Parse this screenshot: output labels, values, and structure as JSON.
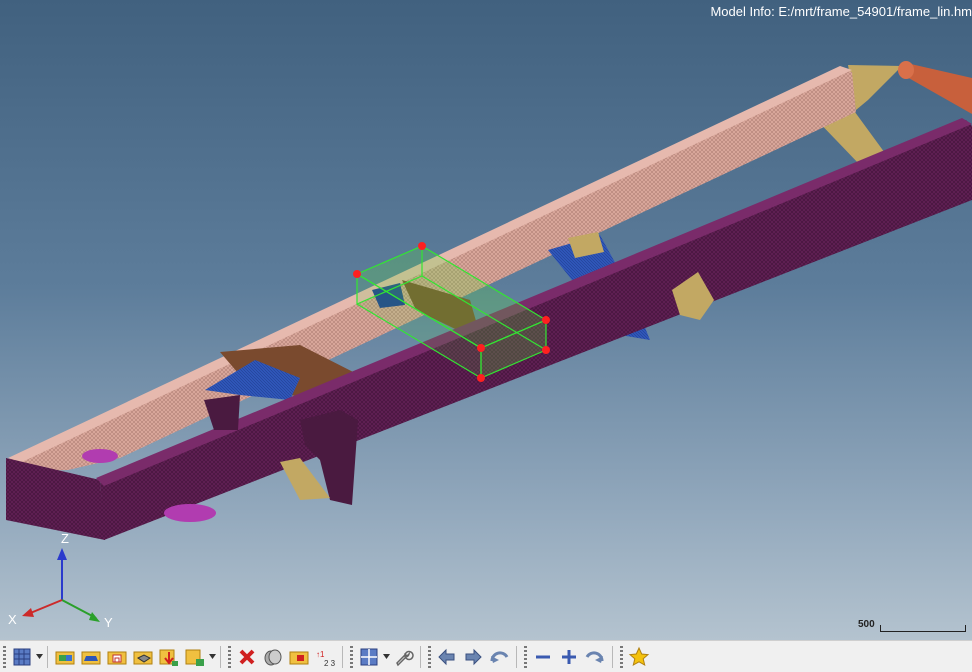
{
  "viewport": {
    "model_info": "Model Info: E:/mrt/frame_54901/frame_lin.hm",
    "axes": {
      "x": "X",
      "y": "Y",
      "z": "Z"
    },
    "scale_label": "500"
  },
  "colors": {
    "left_rail": "#d8a69a",
    "right_rail": "#5e1f52",
    "cross_member": "#7a4a2e",
    "bracket_blue": "#2f56b8",
    "bracket_yellow": "#c2a863",
    "selection_box": "#32e632",
    "handle": "#ff2020"
  },
  "toolbar": {
    "items": [
      {
        "name": "mesh-display-icon",
        "dd": true
      },
      {
        "name": "open-model-icon"
      },
      {
        "name": "import-geometry-icon"
      },
      {
        "name": "save-file-icon"
      },
      {
        "name": "export-icon"
      },
      {
        "name": "import-solver-icon"
      },
      {
        "name": "export-solver-icon",
        "dd": true
      },
      {
        "name": "delete-icon"
      },
      {
        "name": "undo-stack-icon"
      },
      {
        "name": "organize-icon"
      },
      {
        "name": "renumber-icon"
      },
      {
        "name": "view-layout-icon",
        "dd": true
      },
      {
        "name": "wrench-icon"
      },
      {
        "name": "arrow-left-icon"
      },
      {
        "name": "arrow-right-icon"
      },
      {
        "name": "undo-arc-icon"
      },
      {
        "name": "zoom-out-icon"
      },
      {
        "name": "zoom-in-icon"
      },
      {
        "name": "redo-arc-icon"
      },
      {
        "name": "favorite-star-icon"
      }
    ]
  }
}
